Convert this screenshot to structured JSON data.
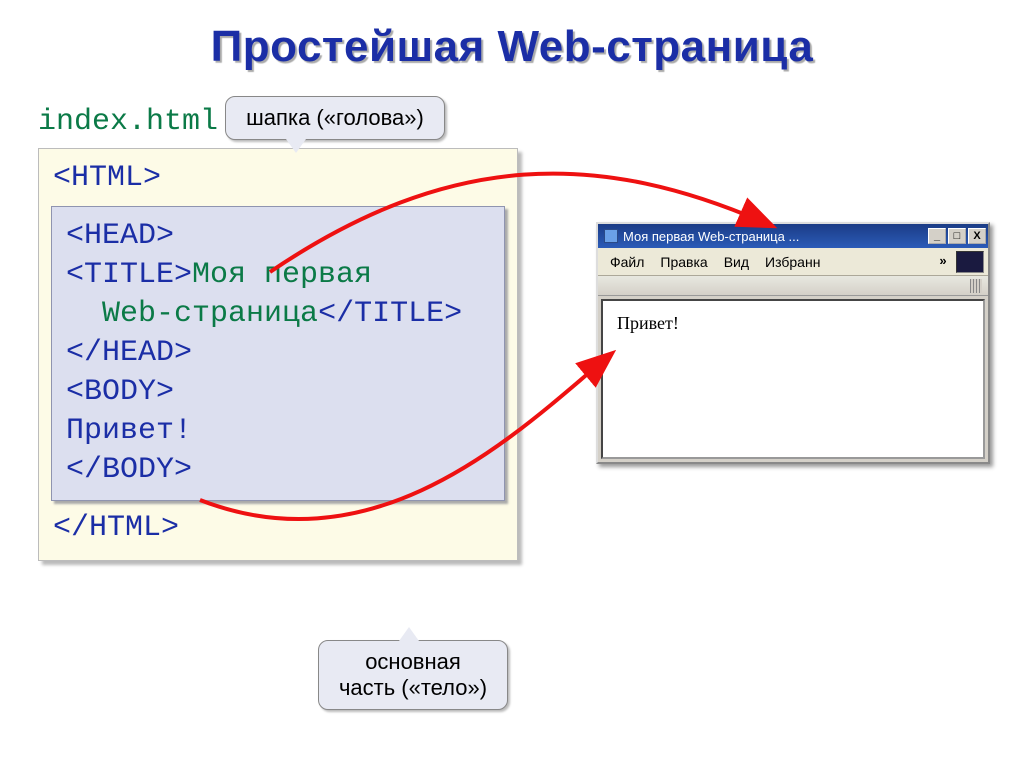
{
  "title": "Простейшая Web-страница",
  "filename": "index.html",
  "code": {
    "html_open": "<HTML>",
    "head_open": "<HEAD>",
    "title_line1": "<TITLE>",
    "title_content1": "Моя первая",
    "title_content2": "Web-страница",
    "title_close": "</TITLE>",
    "head_close": "</HEAD>",
    "body_open": "<BODY>",
    "greeting": "Привет!",
    "body_close": "</BODY>",
    "html_close": "</HTML>"
  },
  "callouts": {
    "head": "шапка («голова»)",
    "body_line1": "основная",
    "body_line2": "часть («тело»)"
  },
  "browser": {
    "title": "Моя первая Web-страница ...",
    "menu": {
      "file": "Файл",
      "edit": "Правка",
      "view": "Вид",
      "favorites": "Избранн",
      "more": "»"
    },
    "page_content": "Привет!",
    "buttons": {
      "min": "_",
      "max": "□",
      "close": "X"
    }
  }
}
